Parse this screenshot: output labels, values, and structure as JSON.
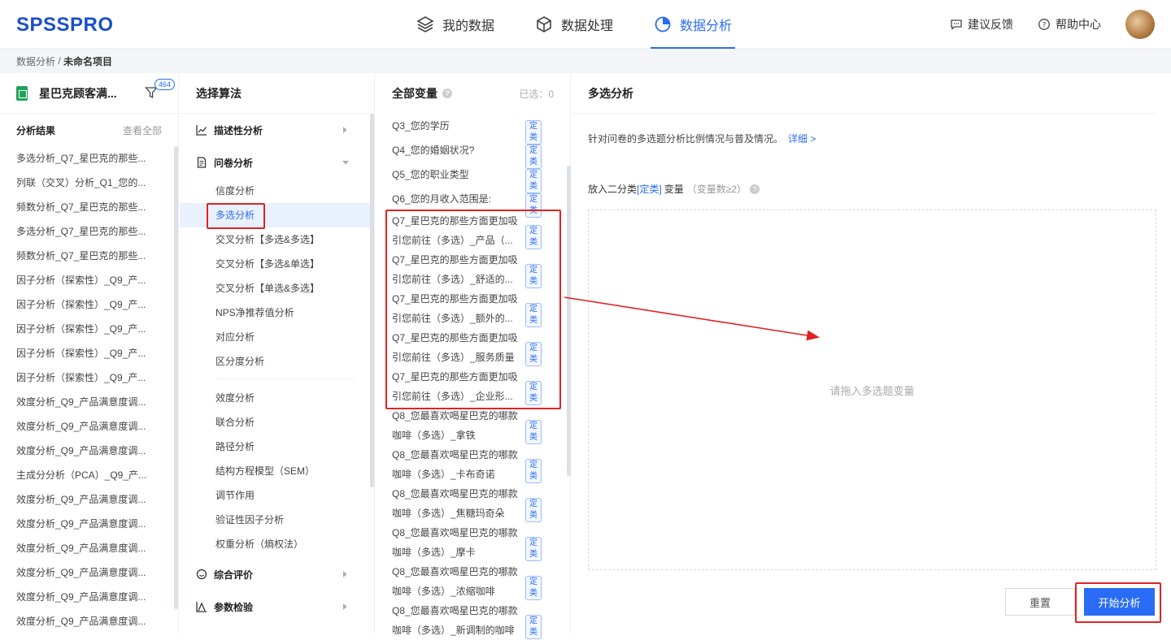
{
  "app": {
    "logo": "SPSSPRO"
  },
  "nav": [
    {
      "label": "我的数据",
      "icon": "layers-icon",
      "active": false
    },
    {
      "label": "数据处理",
      "icon": "cube-icon",
      "active": false
    },
    {
      "label": "数据分析",
      "icon": "pie-chart-icon",
      "active": true
    }
  ],
  "header_right": {
    "feedback": "建议反馈",
    "help": "帮助中心"
  },
  "breadcrumb": {
    "root": "数据分析",
    "sep": " / ",
    "current": "未命名项目"
  },
  "dataset": {
    "name": "星巴克顾客满...",
    "badge": "464"
  },
  "results": {
    "title": "分析结果",
    "view_all": "查看全部",
    "items": [
      "多选分析_Q7_星巴克的那些...",
      "列联（交叉）分析_Q1_您的...",
      "频数分析_Q7_星巴克的那些...",
      "多选分析_Q7_星巴克的那些...",
      "频数分析_Q7_星巴克的那些...",
      "因子分析（探索性）_Q9_产...",
      "因子分析（探索性）_Q9_产...",
      "因子分析（探索性）_Q9_产...",
      "因子分析（探索性）_Q9_产...",
      "因子分析（探索性）_Q9_产...",
      "效度分析_Q9_产品满意度调...",
      "效度分析_Q9_产品满意度调...",
      "效度分析_Q9_产品满意度调...",
      "主成分分析（PCA）_Q9_产...",
      "效度分析_Q9_产品满意度调...",
      "效度分析_Q9_产品满意度调...",
      "效度分析_Q9_产品满意度调...",
      "效度分析_Q9_产品满意度调...",
      "效度分析_Q9_产品满意度调...",
      "效度分析_Q9_产品满意度调..."
    ]
  },
  "algorithms": {
    "title": "选择算法",
    "cat_descriptive": "描述性分析",
    "cat_questionnaire": "问卷分析",
    "questionnaire_items": [
      "信度分析",
      "多选分析",
      "交叉分析【多选&多选】",
      "交叉分析【多选&单选】",
      "交叉分析【单选&多选】",
      "NPS净推荐值分析",
      "对应分析",
      "区分度分析"
    ],
    "questionnaire_items2": [
      "效度分析",
      "联合分析",
      "路径分析",
      "结构方程模型（SEM）",
      "调节作用",
      "验证性因子分析",
      "权重分析（熵权法）"
    ],
    "cat_eval": "综合评价",
    "cat_param": "参数检验"
  },
  "variables": {
    "title": "全部变量",
    "selected": "已选：0",
    "tag": "定类",
    "single_items": [
      "Q3_您的学历",
      "Q4_您的婚姻状况?",
      "Q5_您的职业类型",
      "Q6_您的月收入范围是:"
    ],
    "q7_items": [
      [
        "Q7_星巴克的那些方面更加吸",
        "引您前往（多选）_产品（..."
      ],
      [
        "Q7_星巴克的那些方面更加吸",
        "引您前往（多选）_舒适的..."
      ],
      [
        "Q7_星巴克的那些方面更加吸",
        "引您前往（多选）_额外的..."
      ],
      [
        "Q7_星巴克的那些方面更加吸",
        "引您前往（多选）_服务质量"
      ],
      [
        "Q7_星巴克的那些方面更加吸",
        "引您前往（多选）_企业形..."
      ]
    ],
    "q8_items": [
      [
        "Q8_您最喜欢喝星巴克的哪款",
        "咖啡（多选）_拿铁"
      ],
      [
        "Q8_您最喜欢喝星巴克的哪款",
        "咖啡（多选）_卡布奇诺"
      ],
      [
        "Q8_您最喜欢喝星巴克的哪款",
        "咖啡（多选）_焦糖玛奇朵"
      ],
      [
        "Q8_您最喜欢喝星巴克的哪款",
        "咖啡（多选）_摩卡"
      ],
      [
        "Q8_您最喜欢喝星巴克的哪款",
        "咖啡（多选）_浓缩咖啡"
      ],
      [
        "Q8_您最喜欢喝星巴克的哪款",
        "咖啡（多选）_新调制的咖啡"
      ]
    ]
  },
  "config": {
    "title": "多选分析",
    "desc": "针对问卷的多选题分析比例情况与普及情况。",
    "detail_link": "详细 >",
    "put_prefix": "放入二分类",
    "put_type": "[定类]",
    "put_suffix": "变量",
    "put_hint": "（变量数≥2）",
    "drop_placeholder": "请拖入多选题变量",
    "reset": "重置",
    "start": "开始分析"
  },
  "colors": {
    "accent": "#2a6cf6",
    "highlight": "#e02323"
  }
}
